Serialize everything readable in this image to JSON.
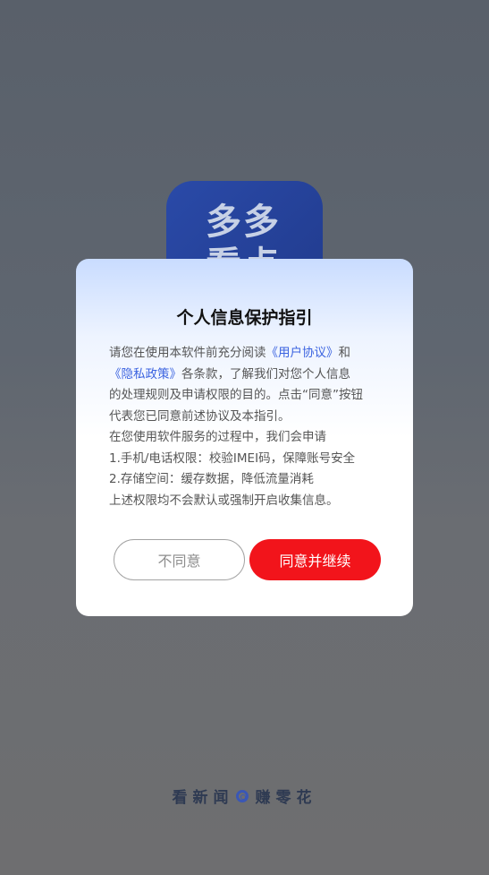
{
  "app_icon": {
    "text": "多多看点"
  },
  "dialog": {
    "title": "个人信息保护指引",
    "body": {
      "l1_pre": "请您在使用本软件前充分阅读",
      "user_agreement": "《用户协议》",
      "l1_post": "和",
      "privacy_policy": "《隐私政策》",
      "l2_post": "各条款，了解我们对您个人信息",
      "l3": "的处理规则及申请权限的目的。点击“同意”按钮",
      "l4": "代表您已同意前述协议及本指引。",
      "l5": "在您使用软件服务的过程中，我们会申请",
      "l6": "1.手机/电话权限：校验IMEI码，保障账号安全",
      "l7": "2.存储空间：缓存数据，降低流量消耗",
      "l8": "上述权限均不会默认或强制开启收集信息。"
    },
    "disagree_label": "不同意",
    "agree_label": "同意并继续"
  },
  "slogan": {
    "left": "看新闻",
    "right": "赚零花",
    "icon": "ring-icon"
  },
  "colors": {
    "accent_red": "#f2141b",
    "link_blue": "#3b63e0",
    "icon_blue": "#2a4aa8"
  }
}
